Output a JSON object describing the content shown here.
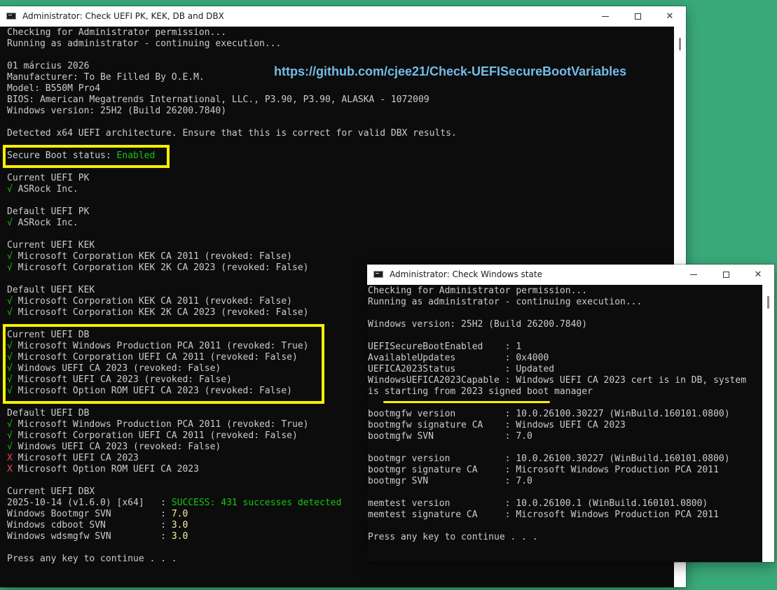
{
  "window1": {
    "title": "Administrator:  Check UEFI PK, KEK, DB and DBX",
    "lines": [
      [
        {
          "t": "Checking for Administrator permission..."
        }
      ],
      [
        {
          "t": "Running as administrator - continuing execution..."
        }
      ],
      [],
      [
        {
          "t": "01 március 2026"
        }
      ],
      [
        {
          "t": "Manufacturer: To Be Filled By O.E.M."
        }
      ],
      [
        {
          "t": "Model: B550M Pro4"
        }
      ],
      [
        {
          "t": "BIOS: American Megatrends International, LLC., P3.90, P3.90, ALASKA - 1072009"
        }
      ],
      [
        {
          "t": "Windows version: 25H2 (Build 26200.7840)"
        }
      ],
      [],
      [
        {
          "t": "Detected x64 UEFI architecture. Ensure that this is correct for valid DBX results."
        }
      ],
      [],
      [
        {
          "t": "Secure Boot status: "
        },
        {
          "t": "Enabled",
          "c": "g"
        }
      ],
      [],
      [
        {
          "t": "Current UEFI PK"
        }
      ],
      [
        {
          "t": "√ ",
          "c": "g"
        },
        {
          "t": "ASRock Inc."
        }
      ],
      [],
      [
        {
          "t": "Default UEFI PK"
        }
      ],
      [
        {
          "t": "√ ",
          "c": "g"
        },
        {
          "t": "ASRock Inc."
        }
      ],
      [],
      [
        {
          "t": "Current UEFI KEK"
        }
      ],
      [
        {
          "t": "√ ",
          "c": "g"
        },
        {
          "t": "Microsoft Corporation KEK CA 2011 (revoked: False)"
        }
      ],
      [
        {
          "t": "√ ",
          "c": "g"
        },
        {
          "t": "Microsoft Corporation KEK 2K CA 2023 (revoked: False)"
        }
      ],
      [],
      [
        {
          "t": "Default UEFI KEK"
        }
      ],
      [
        {
          "t": "√ ",
          "c": "g"
        },
        {
          "t": "Microsoft Corporation KEK CA 2011 (revoked: False)"
        }
      ],
      [
        {
          "t": "√ ",
          "c": "g"
        },
        {
          "t": "Microsoft Corporation KEK 2K CA 2023 (revoked: False)"
        }
      ],
      [],
      [
        {
          "t": "Current UEFI DB"
        }
      ],
      [
        {
          "t": "√ ",
          "c": "g"
        },
        {
          "t": "Microsoft Windows Production PCA 2011 (revoked: True)"
        }
      ],
      [
        {
          "t": "√ ",
          "c": "g"
        },
        {
          "t": "Microsoft Corporation UEFI CA 2011 (revoked: False)"
        }
      ],
      [
        {
          "t": "√ ",
          "c": "g"
        },
        {
          "t": "Windows UEFI CA 2023 (revoked: False)"
        }
      ],
      [
        {
          "t": "√ ",
          "c": "g"
        },
        {
          "t": "Microsoft UEFI CA 2023 (revoked: False)"
        }
      ],
      [
        {
          "t": "√ ",
          "c": "g"
        },
        {
          "t": "Microsoft Option ROM UEFI CA 2023 (revoked: False)"
        }
      ],
      [],
      [
        {
          "t": "Default UEFI DB"
        }
      ],
      [
        {
          "t": "√ ",
          "c": "g"
        },
        {
          "t": "Microsoft Windows Production PCA 2011 (revoked: True)"
        }
      ],
      [
        {
          "t": "√ ",
          "c": "g"
        },
        {
          "t": "Microsoft Corporation UEFI CA 2011 (revoked: False)"
        }
      ],
      [
        {
          "t": "√ ",
          "c": "g"
        },
        {
          "t": "Windows UEFI CA 2023 (revoked: False)"
        }
      ],
      [
        {
          "t": "X ",
          "c": "r"
        },
        {
          "t": "Microsoft UEFI CA 2023"
        }
      ],
      [
        {
          "t": "X ",
          "c": "r"
        },
        {
          "t": "Microsoft Option ROM UEFI CA 2023"
        }
      ],
      [],
      [
        {
          "t": "Current UEFI DBX"
        }
      ],
      [
        {
          "t": "2025-10-14 (v1.6.0) [x64]   : "
        },
        {
          "t": "SUCCESS: 431 successes detected",
          "c": "g"
        }
      ],
      [
        {
          "t": "Windows Bootmgr SVN         : "
        },
        {
          "t": "7.0",
          "c": "y"
        }
      ],
      [
        {
          "t": "Windows cdboot SVN          : "
        },
        {
          "t": "3.0",
          "c": "y"
        }
      ],
      [
        {
          "t": "Windows wdsmgfw SVN         : "
        },
        {
          "t": "3.0",
          "c": "y"
        }
      ],
      [],
      [
        {
          "t": "Press any key to continue . . ."
        }
      ]
    ]
  },
  "overlay_url": "https://github.com/cjee21/Check-UEFISecureBootVariables",
  "window2": {
    "title": "Administrator:  Check Windows state",
    "lines": [
      [
        {
          "t": "Checking for Administrator permission..."
        }
      ],
      [
        {
          "t": "Running as administrator - continuing execution..."
        }
      ],
      [],
      [
        {
          "t": "Windows version: 25H2 (Build 26200.7840)"
        }
      ],
      [],
      [
        {
          "t": "UEFISecureBootEnabled    : 1"
        }
      ],
      [
        {
          "t": "AvailableUpdates         : 0x4000"
        }
      ],
      [
        {
          "t": "UEFICA2023Status         : Updated"
        }
      ],
      [
        {
          "t": "WindowsUEFICA2023Capable : Windows UEFI CA 2023 cert is in DB, system"
        }
      ],
      [
        {
          "t": "is starting from 2023 signed boot manager"
        }
      ],
      [],
      [
        {
          "t": "bootmgfw version         : 10.0.26100.30227 (WinBuild.160101.0800)"
        }
      ],
      [
        {
          "t": "bootmgfw signature CA    : Windows UEFI CA 2023"
        }
      ],
      [
        {
          "t": "bootmgfw SVN             : 7.0"
        }
      ],
      [],
      [
        {
          "t": "bootmgr version          : 10.0.26100.30227 (WinBuild.160101.0800)"
        }
      ],
      [
        {
          "t": "bootmgr signature CA     : Microsoft Windows Production PCA 2011"
        }
      ],
      [
        {
          "t": "bootmgr SVN              : 7.0"
        }
      ],
      [],
      [
        {
          "t": "memtest version          : 10.0.26100.1 (WinBuild.160101.0800)"
        }
      ],
      [
        {
          "t": "memtest signature CA     : Microsoft Windows Production PCA 2011"
        }
      ],
      [],
      [
        {
          "t": "Press any key to continue . . ."
        }
      ]
    ]
  },
  "icons": {
    "app": "terminal-icon",
    "minimize": "minimize-icon",
    "maximize": "maximize-icon",
    "close": "close-icon"
  },
  "colors": {
    "desktop": "#3aa979",
    "console_bg": "#0c0c0c",
    "console_text": "#cccccc",
    "success_green": "#16c60c",
    "svn_yellow": "#f9f1a5",
    "fail_red": "#e74856",
    "highlight_yellow": "#f5f000",
    "url_blue": "#73bde8"
  }
}
